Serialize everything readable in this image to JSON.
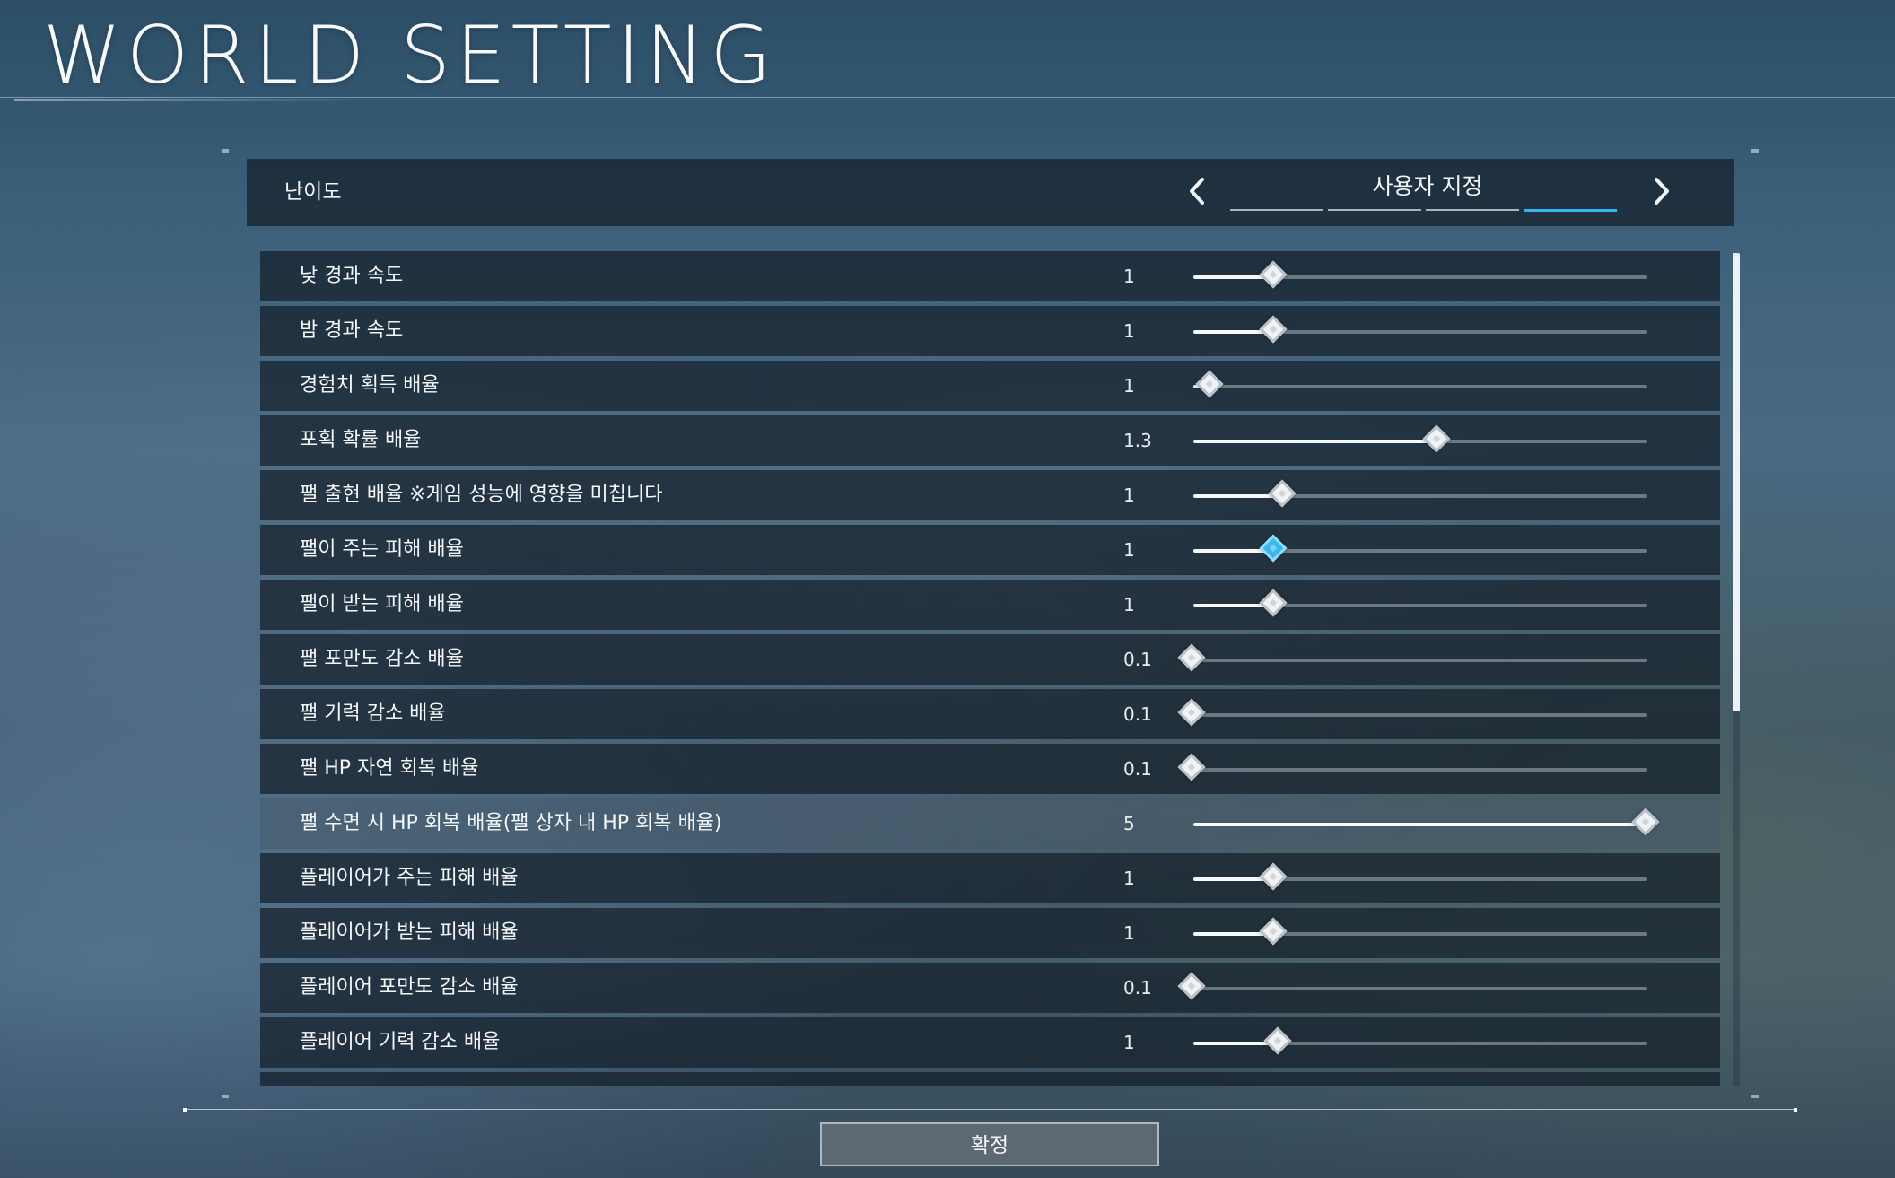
{
  "header": {
    "title": "WORLD SETTING"
  },
  "difficulty": {
    "label": "난이도",
    "value": "사용자 지정",
    "segments": 4,
    "active_segment": 3
  },
  "settings": [
    {
      "label": "낮 경과 속도",
      "value": "1",
      "level": 0.18
    },
    {
      "label": "밤 경과 속도",
      "value": "1",
      "level": 0.18
    },
    {
      "label": "경험치 획득 배율",
      "value": "1",
      "level": 0.04
    },
    {
      "label": "포획 확률 배율",
      "value": "1.3",
      "level": 0.54
    },
    {
      "label": "팰 출현 배율 ※게임 성능에 영향을 미칩니다",
      "value": "1",
      "level": 0.2
    },
    {
      "label": "팰이 주는 피해 배율",
      "value": "1",
      "level": 0.18,
      "focused": true
    },
    {
      "label": "팰이 받는 피해 배율",
      "value": "1",
      "level": 0.18
    },
    {
      "label": "팰 포만도 감소 배율",
      "value": "0.1",
      "level": 0.0
    },
    {
      "label": "팰 기력 감소 배율",
      "value": "0.1",
      "level": 0.0
    },
    {
      "label": "팰 HP 자연 회복 배율",
      "value": "0.1",
      "level": 0.0
    },
    {
      "label": "팰 수면 시 HP 회복 배율(팰 상자 내 HP 회복 배율)",
      "value": "5",
      "level": 1.0,
      "highlight": true
    },
    {
      "label": "플레이어가 주는 피해 배율",
      "value": "1",
      "level": 0.18
    },
    {
      "label": "플레이어가 받는 피해 배율",
      "value": "1",
      "level": 0.18
    },
    {
      "label": "플레이어 포만도 감소 배율",
      "value": "0.1",
      "level": 0.0
    },
    {
      "label": "플레이어 기력 감소 배율",
      "value": "1",
      "level": 0.19
    }
  ],
  "scroll": {
    "thumb_fraction": 0.55,
    "position": 0.0
  },
  "footer": {
    "confirm_label": "확정"
  },
  "colors": {
    "accent": "#35b4ea",
    "panel": "#141e28",
    "text": "#f2f5f7"
  },
  "icons": {
    "prev": "chevron-left-icon",
    "next": "chevron-right-icon"
  }
}
